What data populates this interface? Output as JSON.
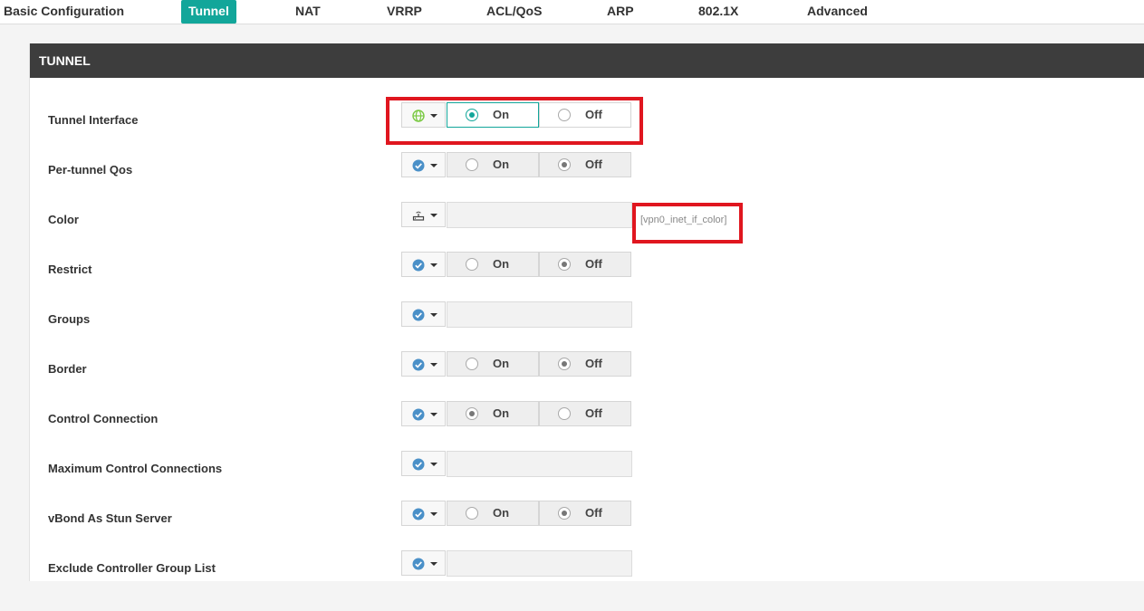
{
  "tabs": [
    {
      "label": "Basic Configuration"
    },
    {
      "label": "Tunnel"
    },
    {
      "label": "NAT"
    },
    {
      "label": "VRRP"
    },
    {
      "label": "ACL/QoS"
    },
    {
      "label": "ARP"
    },
    {
      "label": "802.1X"
    },
    {
      "label": "Advanced"
    }
  ],
  "active_tab": "Tunnel",
  "section": {
    "title": "TUNNEL"
  },
  "radio_labels": {
    "on": "On",
    "off": "Off"
  },
  "fields": [
    {
      "label": "Tunnel Interface",
      "type": "radio",
      "scope_icon": "globe-icon",
      "value": "On"
    },
    {
      "label": "Per-tunnel Qos",
      "type": "radio",
      "scope_icon": "check-circle-icon",
      "value": "Off"
    },
    {
      "label": "Color",
      "type": "text",
      "scope_icon": "device-icon",
      "value": "",
      "variable": "[vpn0_inet_if_color]"
    },
    {
      "label": "Restrict",
      "type": "radio",
      "scope_icon": "check-circle-icon",
      "value": "Off"
    },
    {
      "label": "Groups",
      "type": "text",
      "scope_icon": "check-circle-icon",
      "value": ""
    },
    {
      "label": "Border",
      "type": "radio",
      "scope_icon": "check-circle-icon",
      "value": "Off"
    },
    {
      "label": "Control Connection",
      "type": "radio",
      "scope_icon": "check-circle-icon",
      "value": "On"
    },
    {
      "label": "Maximum Control Connections",
      "type": "text",
      "scope_icon": "check-circle-icon",
      "value": ""
    },
    {
      "label": "vBond As Stun Server",
      "type": "radio",
      "scope_icon": "check-circle-icon",
      "value": "Off"
    },
    {
      "label": "Exclude Controller Group List",
      "type": "text",
      "scope_icon": "check-circle-icon",
      "value": ""
    }
  ],
  "colors": {
    "accent": "#12a69a",
    "header_bg": "#3d3d3d",
    "highlight": "#e0161f",
    "globe_icon": "#7ac943",
    "check_icon": "#4a90c8"
  }
}
